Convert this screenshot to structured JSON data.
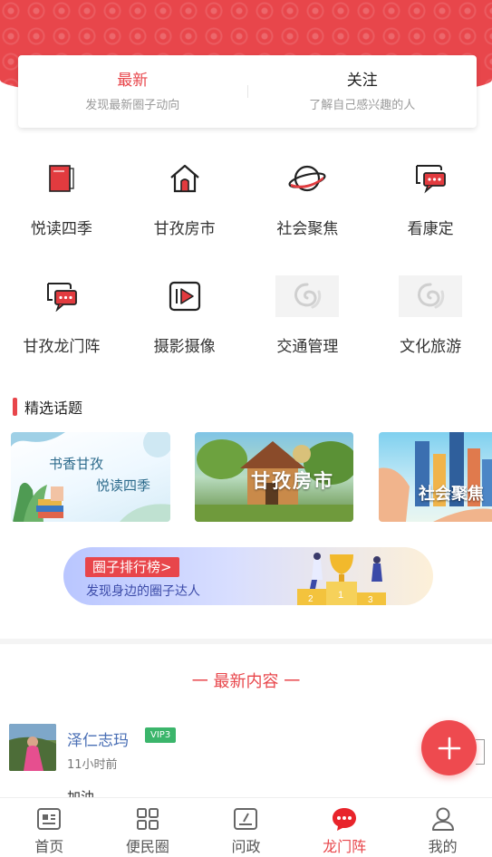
{
  "colors": {
    "accent": "#e8464b",
    "vip": "#3bb56b",
    "link": "#4a6fb5"
  },
  "tabs": [
    {
      "title": "最新",
      "subtitle": "发现最新圈子动向",
      "active": true
    },
    {
      "title": "关注",
      "subtitle": "了解自己感兴趣的人",
      "active": false
    }
  ],
  "circles": [
    {
      "label": "悦读四季",
      "icon": "book-icon"
    },
    {
      "label": "甘孜房市",
      "icon": "house-icon"
    },
    {
      "label": "社会聚焦",
      "icon": "planet-icon"
    },
    {
      "label": "看康定",
      "icon": "chat-bubble-icon"
    },
    {
      "label": "甘孜龙门阵",
      "icon": "chat-bubbles-icon"
    },
    {
      "label": "摄影摄像",
      "icon": "video-play-icon"
    },
    {
      "label": "交通管理",
      "icon": "placeholder-logo-icon"
    },
    {
      "label": "文化旅游",
      "icon": "placeholder-logo-icon"
    }
  ],
  "featured": {
    "title": "精选话题",
    "topics": [
      {
        "line1": "书香甘孜",
        "line2": "悦读四季"
      },
      {
        "caption": "甘孜房市"
      },
      {
        "caption": "社会聚焦"
      }
    ]
  },
  "ranking": {
    "tag": "圈子排行榜>",
    "subtitle": "发现身边的圈子达人"
  },
  "latest": {
    "title": "一 最新内容 一"
  },
  "post": {
    "name": "泽仁志玛",
    "badge": "VIP3",
    "time": "11小时前",
    "body_peek": "加油"
  },
  "tabbar": [
    {
      "label": "首页",
      "icon": "news-icon",
      "active": false
    },
    {
      "label": "便民圈",
      "icon": "grid-icon",
      "active": false
    },
    {
      "label": "问政",
      "icon": "edit-icon",
      "active": false
    },
    {
      "label": "龙门阵",
      "icon": "chat-dots-icon",
      "active": true
    },
    {
      "label": "我的",
      "icon": "user-icon",
      "active": false
    }
  ]
}
